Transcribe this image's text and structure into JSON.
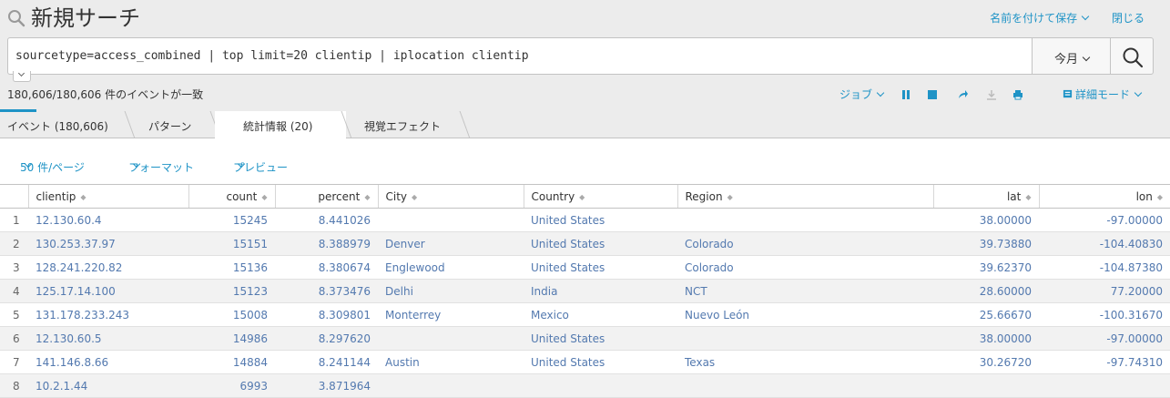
{
  "header": {
    "title": "新規サーチ",
    "save_as": "名前を付けて保存",
    "close": "閉じる"
  },
  "search": {
    "query": "sourcetype=access_combined | top limit=20 clientip | iplocation clientip",
    "time_range": "今月"
  },
  "status": {
    "event_count": "180,606/180,606 件のイベントが一致",
    "job_label": "ジョブ",
    "mode_label": "詳細モード"
  },
  "tabs": [
    {
      "label": "イベント (180,606)"
    },
    {
      "label": "パターン"
    },
    {
      "label": "統計情報 (20)"
    },
    {
      "label": "視覚エフェクト"
    }
  ],
  "results_bar": {
    "per_page": "50 件/ページ",
    "format": "フォーマット",
    "preview": "プレビュー"
  },
  "table": {
    "columns": [
      "clientip",
      "count",
      "percent",
      "City",
      "Country",
      "Region",
      "lat",
      "lon"
    ],
    "rows": [
      {
        "idx": "1",
        "clientip": "12.130.60.4",
        "count": "15245",
        "percent": "8.441026",
        "city": "",
        "country": "United States",
        "region": "",
        "lat": "38.00000",
        "lon": "-97.00000"
      },
      {
        "idx": "2",
        "clientip": "130.253.37.97",
        "count": "15151",
        "percent": "8.388979",
        "city": "Denver",
        "country": "United States",
        "region": "Colorado",
        "lat": "39.73880",
        "lon": "-104.40830"
      },
      {
        "idx": "3",
        "clientip": "128.241.220.82",
        "count": "15136",
        "percent": "8.380674",
        "city": "Englewood",
        "country": "United States",
        "region": "Colorado",
        "lat": "39.62370",
        "lon": "-104.87380"
      },
      {
        "idx": "4",
        "clientip": "125.17.14.100",
        "count": "15123",
        "percent": "8.373476",
        "city": "Delhi",
        "country": "India",
        "region": "NCT",
        "lat": "28.60000",
        "lon": "77.20000"
      },
      {
        "idx": "5",
        "clientip": "131.178.233.243",
        "count": "15008",
        "percent": "8.309801",
        "city": "Monterrey",
        "country": "Mexico",
        "region": "Nuevo León",
        "lat": "25.66670",
        "lon": "-100.31670"
      },
      {
        "idx": "6",
        "clientip": "12.130.60.5",
        "count": "14986",
        "percent": "8.297620",
        "city": "",
        "country": "United States",
        "region": "",
        "lat": "38.00000",
        "lon": "-97.00000"
      },
      {
        "idx": "7",
        "clientip": "141.146.8.66",
        "count": "14884",
        "percent": "8.241144",
        "city": "Austin",
        "country": "United States",
        "region": "Texas",
        "lat": "30.26720",
        "lon": "-97.74310"
      },
      {
        "idx": "8",
        "clientip": "10.2.1.44",
        "count": "6993",
        "percent": "3.871964",
        "city": "",
        "country": "",
        "region": "",
        "lat": "",
        "lon": ""
      }
    ]
  },
  "colors": {
    "link": "#1e93c6",
    "cell_value": "#5379af",
    "row_alt": "#f2f2f2"
  }
}
